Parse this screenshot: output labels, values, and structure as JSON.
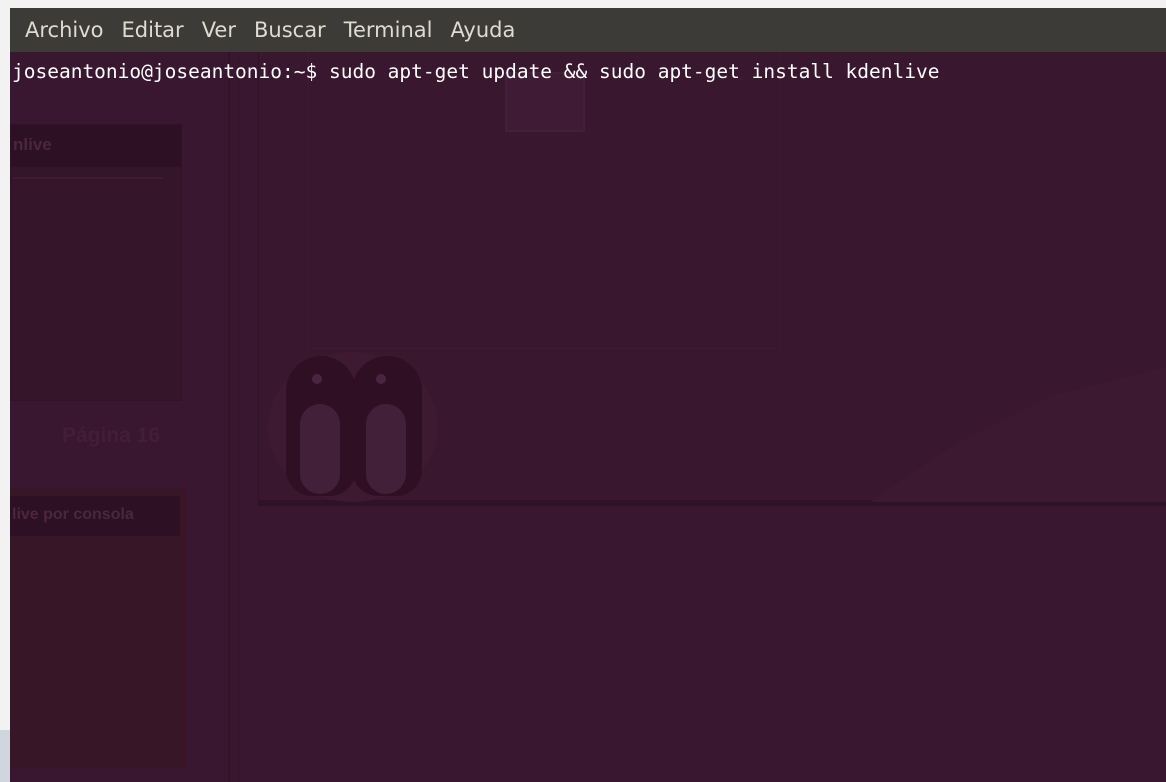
{
  "menubar": {
    "items": [
      {
        "label": "Archivo"
      },
      {
        "label": "Editar"
      },
      {
        "label": "Ver"
      },
      {
        "label": "Buscar"
      },
      {
        "label": "Terminal"
      },
      {
        "label": "Ayuda"
      }
    ]
  },
  "terminal": {
    "prompt": "joseantonio@joseantonio:~$ ",
    "command": "sudo apt-get update && sudo apt-get install kdenlive"
  },
  "background": {
    "panel1_title": "nlive",
    "page_label": "Página 16",
    "panel2_title": "live por consola"
  },
  "colors": {
    "terminal_bg": "#3a1730",
    "menubar_bg": "#3c3b37",
    "menu_text": "#dfdbd2",
    "terminal_text": "#ffffff"
  }
}
